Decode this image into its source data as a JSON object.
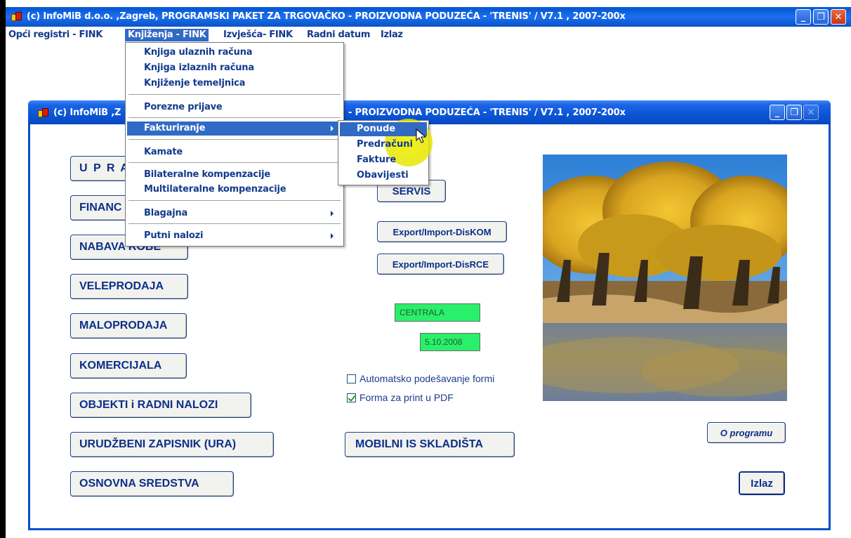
{
  "window": {
    "title": "(c) InfoMiB d.o.o. ,Zagreb, PROGRAMSKI PAKET ZA TRGOVAČKO - PROIZVODNA PODUZEĆA - 'TRENIS' / V7.1 , 2007-200x",
    "minimize": "_",
    "restore": "❐",
    "close": "✕"
  },
  "menubar": [
    {
      "label": "Opći registri  - FINK"
    },
    {
      "label": "Knjiženja - FINK"
    },
    {
      "label": "Izvješća- FINK"
    },
    {
      "label": "Radni datum"
    },
    {
      "label": "Izlaz"
    }
  ],
  "inner_window": {
    "title": "(c) InfoMiB ,Zagreb, PROGRAMSKI PAKET ZA TRGOVAČKO - PROIZVODNA PODUZEĆA - 'TRENIS' / V7.1 , 2007-200x",
    "title_visible_left": "(c) InfoMiB ,Z",
    "title_visible_right": "- PROIZVODNA PODUZEĆA - 'TRENIS' / V7.1 , 2007-200x"
  },
  "main_buttons": [
    {
      "label": "U P R A"
    },
    {
      "label": "FINANC"
    },
    {
      "label": "NABAVA ROBE"
    },
    {
      "label": "VELEPRODAJA"
    },
    {
      "label": "MALOPRODAJA"
    },
    {
      "label": "KOMERCIJALA"
    },
    {
      "label": "OBJEKTI i RADNI NALOZI"
    },
    {
      "label": "URUDŽBENI ZAPISNIK (URA)"
    },
    {
      "label": "OSNOVNA SREDSTVA"
    }
  ],
  "right_buttons": {
    "servis": "SERVIS",
    "export_diskom": "Export/Import-DisKOM",
    "export_disrce": "Export/Import-DisRCE",
    "mobilni": "MOBILNI IS SKLADIŠTA",
    "o_programu": "O programu",
    "izlaz": "Izlaz"
  },
  "status": {
    "location": "CENTRALA",
    "date": "5.10.2008"
  },
  "options": {
    "auto_forms": {
      "label": "Automatsko podešavanje formi",
      "checked": false
    },
    "pdf_print": {
      "label": "Forma za print u PDF",
      "checked": true
    }
  },
  "dropdown": {
    "items": [
      {
        "label": "Knjiga ulaznih računa"
      },
      {
        "label": "Knjiga izlaznih računa"
      },
      {
        "label": "Knjiženje temeljnica"
      },
      {
        "label": "Porezne prijave"
      },
      {
        "label": "Fakturiranje"
      },
      {
        "label": "Kamate"
      },
      {
        "label": "Bilateralne kompenzacije"
      },
      {
        "label": "Multilateralne kompenzacije"
      },
      {
        "label": "Blagajna"
      },
      {
        "label": "Putni nalozi"
      }
    ]
  },
  "submenu": {
    "items": [
      {
        "label": "Ponude"
      },
      {
        "label": "Predračuni"
      },
      {
        "label": "Fakture"
      },
      {
        "label": "Obavijesti"
      }
    ]
  }
}
